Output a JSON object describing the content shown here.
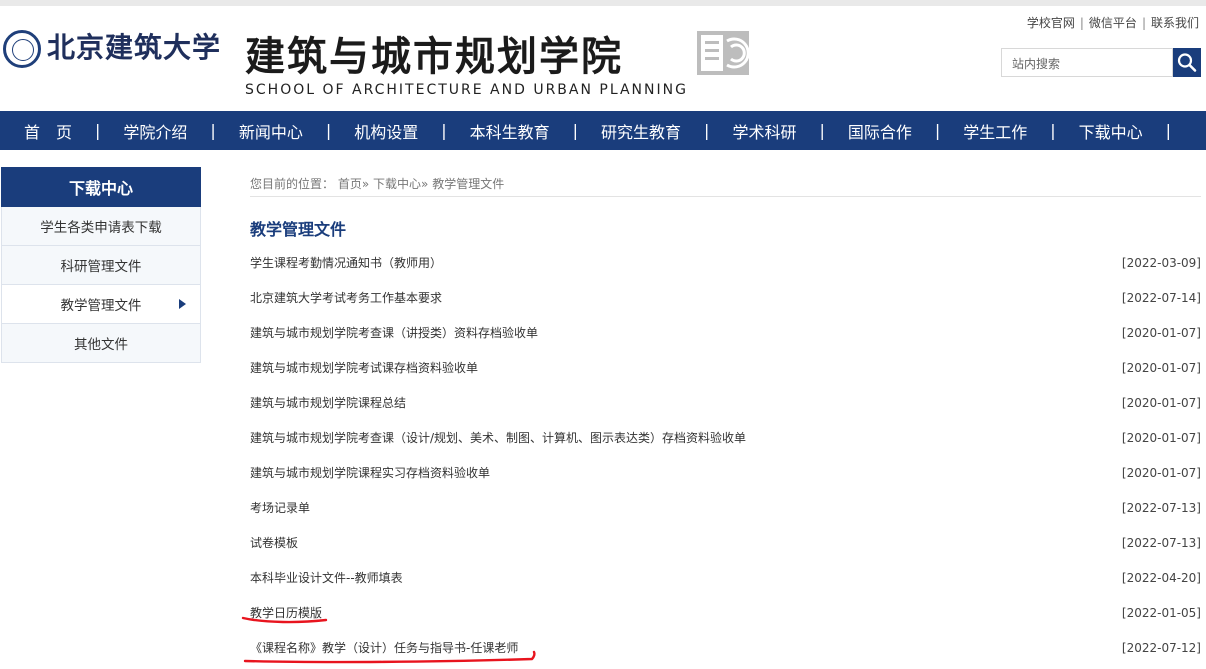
{
  "header": {
    "university_name": "北京建筑大学",
    "school_name_cn": "建筑与城市规划学院",
    "school_name_en": "SCHOOL OF ARCHITECTURE AND URBAN PLANNING",
    "top_links": [
      "学校官网",
      "微信平台",
      "联系我们"
    ],
    "search_placeholder": "站内搜索",
    "icons": {
      "logo": "university-seal-icon",
      "school_logo": "school-emblem-icon",
      "search": "search-icon"
    }
  },
  "nav": {
    "items": [
      "首　页",
      "学院介绍",
      "新闻中心",
      "机构设置",
      "本科生教育",
      "研究生教育",
      "学术科研",
      "国际合作",
      "学生工作",
      "下载中心"
    ]
  },
  "sidebar": {
    "title": "下载中心",
    "items": [
      {
        "label": "学生各类申请表下载",
        "active": false
      },
      {
        "label": "科研管理文件",
        "active": false
      },
      {
        "label": "教学管理文件",
        "active": true
      },
      {
        "label": "其他文件",
        "active": false
      }
    ]
  },
  "main": {
    "breadcrumb": {
      "prefix": "您目前的位置：",
      "home": "首页",
      "level1": "下载中心",
      "level2": "教学管理文件",
      "separator": "»"
    },
    "section_title": "教学管理文件",
    "files": [
      {
        "title": "学生课程考勤情况通知书（教师用）",
        "date": "[2022-03-09]"
      },
      {
        "title": "北京建筑大学考试考务工作基本要求",
        "date": "[2022-07-14]"
      },
      {
        "title": "建筑与城市规划学院考查课（讲授类）资料存档验收单",
        "date": "[2020-01-07]"
      },
      {
        "title": "建筑与城市规划学院考试课存档资料验收单",
        "date": "[2020-01-07]"
      },
      {
        "title": "建筑与城市规划学院课程总结",
        "date": "[2020-01-07]"
      },
      {
        "title": "建筑与城市规划学院考查课（设计/规划、美术、制图、计算机、图示表达类）存档资料验收单",
        "date": "[2020-01-07]"
      },
      {
        "title": "建筑与城市规划学院课程实习存档资料验收单",
        "date": "[2020-01-07]"
      },
      {
        "title": "考场记录单",
        "date": "[2022-07-13]"
      },
      {
        "title": "试卷模板",
        "date": "[2022-07-13]"
      },
      {
        "title": "本科毕业设计文件--教师填表",
        "date": "[2022-04-20]"
      },
      {
        "title": "教学日历模版",
        "date": "[2022-01-05]"
      },
      {
        "title": "《课程名称》教学（设计）任务与指导书-任课老师",
        "date": "[2022-07-12]"
      }
    ]
  },
  "colors": {
    "primary": "#1a3d7c",
    "annotation": "#e8141e",
    "sidebar_bg": "#f5f8fb"
  }
}
